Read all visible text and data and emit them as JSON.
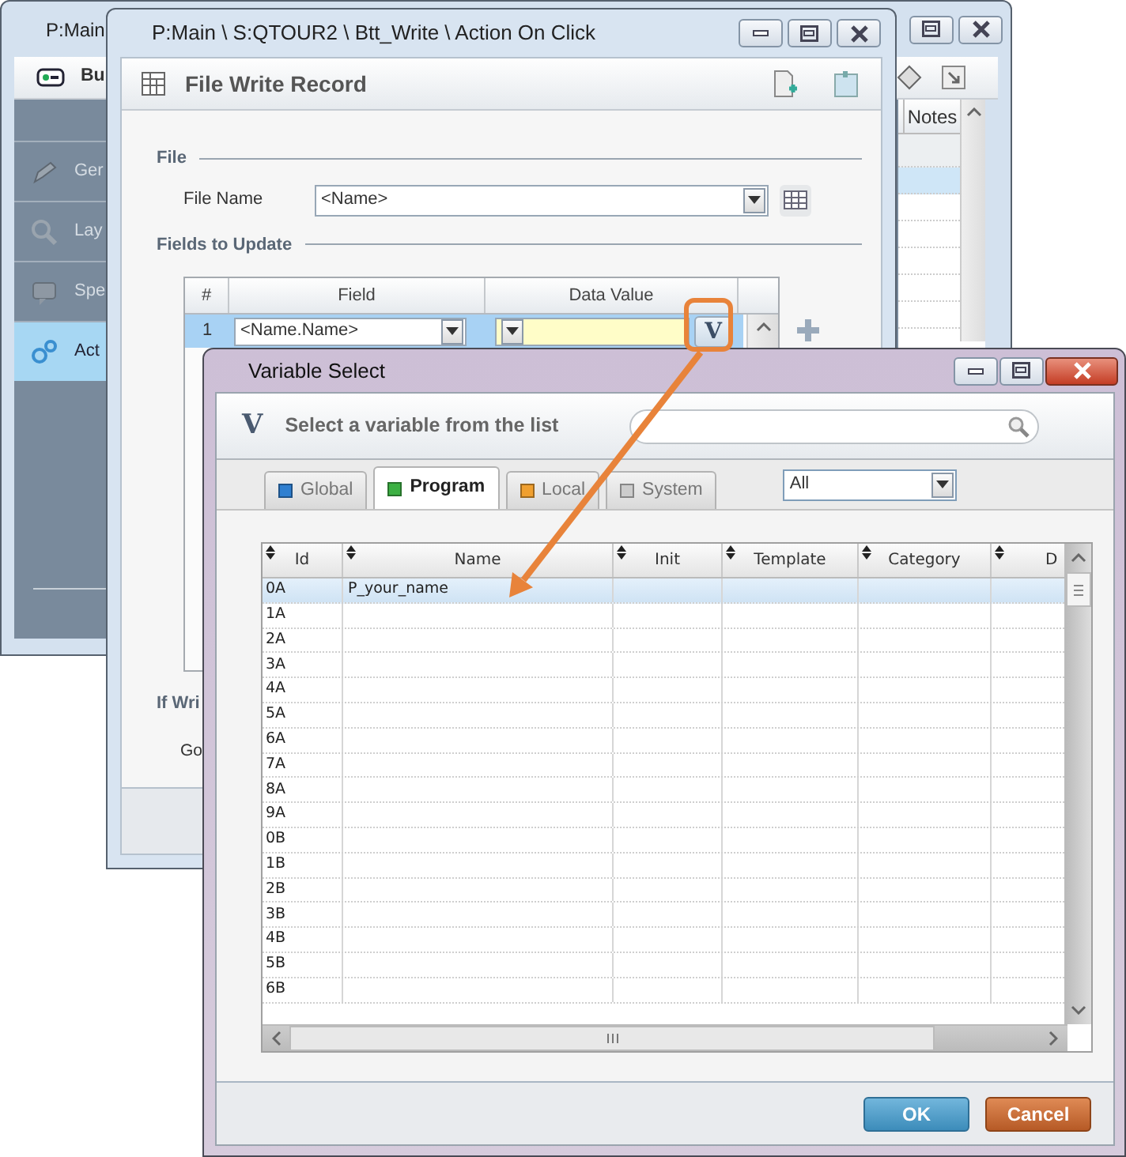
{
  "background_window": {
    "title": "P:Main",
    "toolbar_label": "Bu",
    "sidebar": {
      "items": [
        {
          "label": "Ger",
          "selected": false
        },
        {
          "label": "Lay",
          "selected": false
        },
        {
          "label": "Spe",
          "selected": false
        },
        {
          "label": "Act",
          "selected": true
        }
      ]
    },
    "grid": {
      "columns": [
        "Notes"
      ],
      "rows": [
        {
          "selected": false
        },
        {
          "selected": true
        },
        {
          "selected": false
        },
        {
          "selected": false
        },
        {
          "selected": false
        },
        {
          "selected": false
        },
        {
          "selected": false
        }
      ]
    }
  },
  "editor_window": {
    "title": "P:Main \\ S:QTOUR2 \\ Btt_Write \\ Action On Click",
    "header": "File Write Record",
    "file_section": {
      "title": "File",
      "file_name_label": "File Name",
      "file_name_value": "<Name>"
    },
    "fields_section": {
      "title": "Fields to Update",
      "columns": [
        "#",
        "Field",
        "Data Value"
      ],
      "value_button": "V",
      "rows": [
        {
          "number": "1",
          "field": "<Name.Name>",
          "selected": true
        }
      ]
    },
    "on_error_section": {
      "title": "If Wri",
      "goto_label": "Go"
    }
  },
  "variable_dialog": {
    "title": "Variable Select",
    "header_icon": "V",
    "header": "Select a variable from the list",
    "tabs": [
      {
        "label": "Global",
        "color": "#2f7fd0",
        "selected": false
      },
      {
        "label": "Program",
        "color": "#3cb043",
        "selected": true
      },
      {
        "label": "Local",
        "color": "#f0a030",
        "selected": false
      },
      {
        "label": "System",
        "color": "#cccccc",
        "selected": false
      }
    ],
    "scope_filter": "All",
    "grid": {
      "columns": [
        "Id",
        "Name",
        "Init",
        "Template",
        "Category",
        "D"
      ],
      "rows": [
        {
          "cells": [
            "0A",
            "P_your_name"
          ],
          "selected": true
        },
        {
          "cells": [
            "1A"
          ],
          "selected": false
        },
        {
          "cells": [
            "2A"
          ],
          "selected": false
        },
        {
          "cells": [
            "3A"
          ],
          "selected": false
        },
        {
          "cells": [
            "4A"
          ],
          "selected": false
        },
        {
          "cells": [
            "5A"
          ],
          "selected": false
        },
        {
          "cells": [
            "6A"
          ],
          "selected": false
        },
        {
          "cells": [
            "7A"
          ],
          "selected": false
        },
        {
          "cells": [
            "8A"
          ],
          "selected": false
        },
        {
          "cells": [
            "9A"
          ],
          "selected": false
        },
        {
          "cells": [
            "0B"
          ],
          "selected": false
        },
        {
          "cells": [
            "1B"
          ],
          "selected": false
        },
        {
          "cells": [
            "2B"
          ],
          "selected": false
        },
        {
          "cells": [
            "3B"
          ],
          "selected": false
        },
        {
          "cells": [
            "4B"
          ],
          "selected": false
        },
        {
          "cells": [
            "5B"
          ],
          "selected": false
        },
        {
          "cells": [
            "6B"
          ],
          "selected": false
        }
      ]
    },
    "buttons": [
      {
        "label": "OK",
        "kind": "primary"
      },
      {
        "label": "Cancel",
        "kind": "cancel"
      }
    ]
  }
}
